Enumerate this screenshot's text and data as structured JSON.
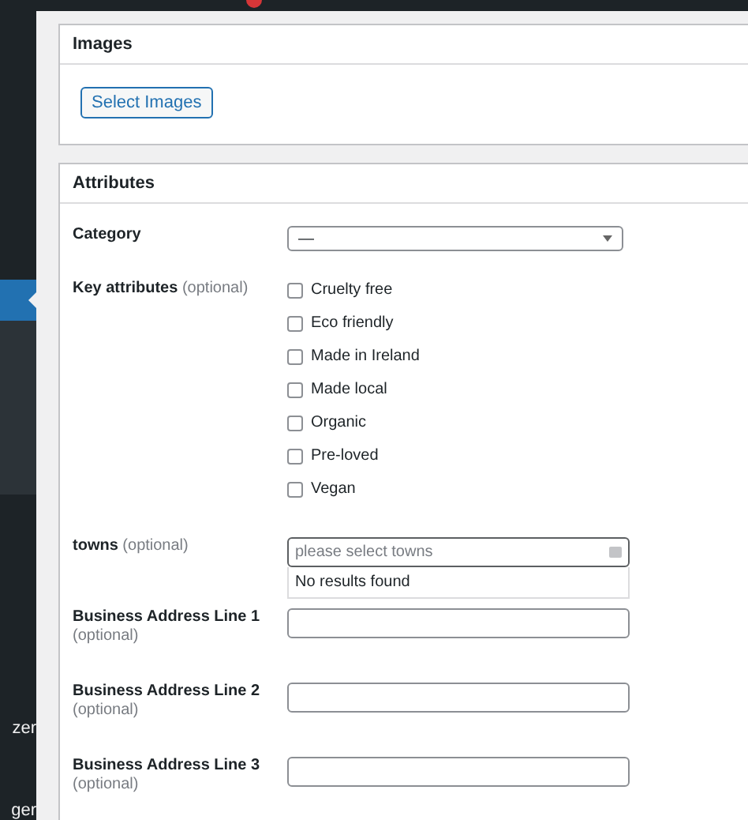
{
  "sidebar": {
    "items": [
      {
        "selected": true
      },
      {
        "label": "zer",
        "selected": false
      },
      {
        "label": "ger",
        "selected": false
      }
    ]
  },
  "images_panel": {
    "title": "Images",
    "button": "Select Images"
  },
  "attributes_panel": {
    "title": "Attributes",
    "category": {
      "label": "Category",
      "value": "—"
    },
    "key_attributes": {
      "label": "Key attributes",
      "hint": "(optional)",
      "options": [
        {
          "label": "Cruelty free",
          "checked": false
        },
        {
          "label": "Eco friendly",
          "checked": false
        },
        {
          "label": "Made in Ireland",
          "checked": false
        },
        {
          "label": "Made local",
          "checked": false
        },
        {
          "label": "Organic",
          "checked": false
        },
        {
          "label": "Pre-loved",
          "checked": false
        },
        {
          "label": "Vegan",
          "checked": false
        }
      ]
    },
    "towns": {
      "label": "towns",
      "hint": "(optional)",
      "placeholder": "please select towns",
      "dropdown_message": "No results found"
    },
    "text_fields": [
      {
        "label": "Business Address Line 1",
        "hint": "(optional)"
      },
      {
        "label": "Business Address Line 2",
        "hint": "(optional)"
      },
      {
        "label": "Business Address Line 3",
        "hint": "(optional)"
      }
    ]
  }
}
